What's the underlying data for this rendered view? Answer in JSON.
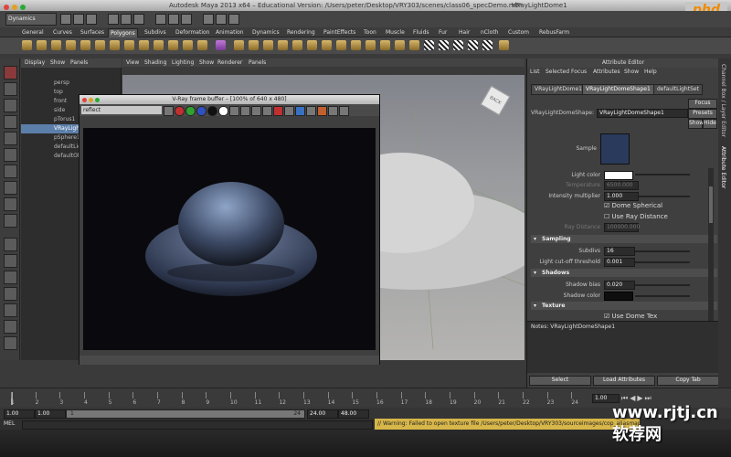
{
  "window": {
    "title_mid": "Autodesk Maya 2013 x64 – Educational Version: /Users/peter/Desktop/VRY303/scenes/class06_specDemo.mb*",
    "title_right": "VRayLightDome1"
  },
  "logo": "phd",
  "mode_menu": "Dynamics",
  "tabs": [
    "General",
    "Curves",
    "Surfaces",
    "Polygons",
    "Subdivs",
    "Deformation",
    "Animation",
    "Dynamics",
    "Rendering",
    "PaintEffects",
    "Toon",
    "Muscle",
    "Fluids",
    "Fur",
    "Hair",
    "nCloth",
    "Custom",
    "RebusFarm"
  ],
  "active_tab": "Polygons",
  "outliner": {
    "menu": [
      "Display",
      "Show",
      "Panels"
    ],
    "items": [
      "persp",
      "top",
      "front",
      "side",
      "pTorus1",
      "VRayLightDome1",
      "pSphere1",
      "defaultLightSet",
      "defaultObjectSet"
    ],
    "selected": "VRayLightDome1"
  },
  "viewport": {
    "menu": [
      "View",
      "Shading",
      "Lighting",
      "Show",
      "Renderer",
      "Panels"
    ],
    "cube_label": "BACK"
  },
  "vfb": {
    "title": "V-Ray frame buffer – [100% of 640 x 480]",
    "channel": "reflect"
  },
  "attr": {
    "title": "Attribute Editor",
    "menu": [
      "List",
      "Selected",
      "Focus",
      "Attributes",
      "Show",
      "Help"
    ],
    "tabs": [
      "VRayLightDome1",
      "VRayLightDomeShape1",
      "defaultLightSet"
    ],
    "active_tab": "VRayLightDomeShape1",
    "shape_label": "VRayLightDomeShape:",
    "shape_value": "VRayLightDomeShape1",
    "focus": "Focus",
    "presets": "Presets",
    "show": "Show",
    "hide": "Hide",
    "sample": "Sample",
    "light_color": "Light color",
    "temperature": "Temperature",
    "temperature_value": "6500.000",
    "intensity_label": "Intensity multiplier",
    "intensity_value": "1.000",
    "dome_spherical": "Dome Spherical",
    "use_ray_distance": "Use Ray Distance",
    "ray_distance": "Ray Distance",
    "ray_distance_value": "100000.000",
    "sampling": "Sampling",
    "subdivs_label": "Subdivs",
    "subdivs_value": "16",
    "cutoff_label": "Light cut-off threshold",
    "cutoff_value": "0.001",
    "shadows": "Shadows",
    "shadow_bias_label": "Shadow bias",
    "shadow_bias_value": "0.020",
    "shadow_color_label": "Shadow color",
    "texture": "Texture",
    "use_dome_tex": "Use Dome Tex",
    "notes": "Notes: VRayLightDomeShape1",
    "select": "Select",
    "load": "Load Attributes",
    "copy": "Copy Tab"
  },
  "side_tabs": [
    "Channel Box / Layer Editor",
    "Attribute Editor"
  ],
  "timeline": {
    "ticks": [
      "1",
      "2",
      "3",
      "4",
      "5",
      "6",
      "7",
      "8",
      "9",
      "10",
      "11",
      "12",
      "13",
      "14",
      "15",
      "16",
      "17",
      "18",
      "19",
      "20",
      "21",
      "22",
      "23",
      "24"
    ],
    "current": "1.00"
  },
  "range": {
    "start": "1.00",
    "start2": "1.00",
    "mid": "1",
    "end": "24",
    "end2": "24.00",
    "end3": "48.00"
  },
  "cmd": {
    "label": "MEL",
    "warning": "// Warning: Failed to open texture file /Users/peter/Desktop/VRY303/sourceimages/cop_aliasmap.png"
  },
  "watermark": "www.rjtj.cn软荐网"
}
